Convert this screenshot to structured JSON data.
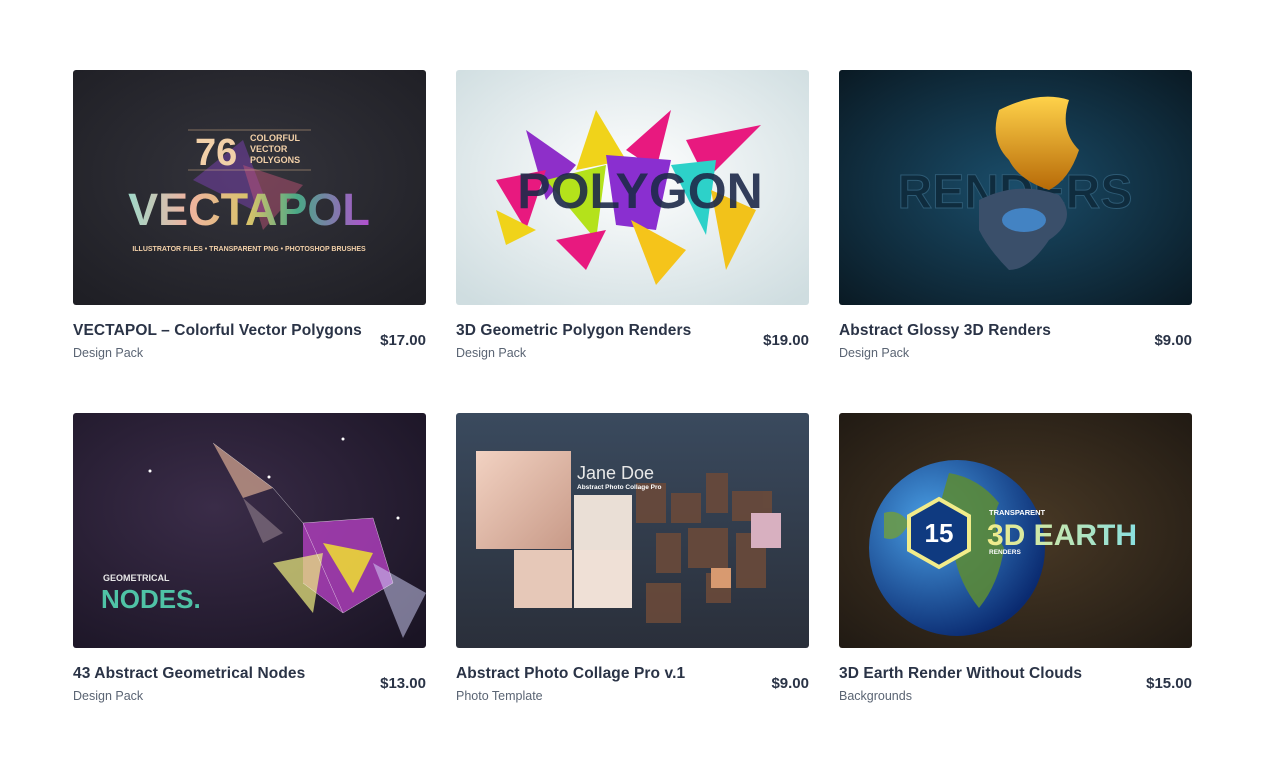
{
  "products": [
    {
      "title": "VECTAPOL – Colorful Vector Polygons",
      "category": "Design Pack",
      "price": "$17.00",
      "thumb": {
        "big_number": "76",
        "small_lines": [
          "COLORFUL",
          "VECTOR",
          "POLYGONS"
        ],
        "headline": "VECTAPOL",
        "footer": "ILLUSTRATOR FILES  •  TRANSPARENT PNG  •  PHOTOSHOP BRUSHES"
      }
    },
    {
      "title": "3D Geometric Polygon Renders",
      "category": "Design Pack",
      "price": "$19.00",
      "thumb": {
        "headline": "POLYGON"
      }
    },
    {
      "title": "Abstract Glossy 3D Renders",
      "category": "Design Pack",
      "price": "$9.00",
      "thumb": {
        "headline": "RENDERS"
      }
    },
    {
      "title": "43 Abstract Geometrical Nodes",
      "category": "Design Pack",
      "price": "$13.00",
      "thumb": {
        "small": "GEOMETRICAL",
        "headline": "NODES."
      }
    },
    {
      "title": "Abstract Photo Collage Pro v.1",
      "category": "Photo Template",
      "price": "$9.00",
      "thumb": {
        "name": "Jane Doe",
        "subtitle": "Abstract Photo Collage Pro"
      }
    },
    {
      "title": "3D Earth Render Without Clouds",
      "category": "Backgrounds",
      "price": "$15.00",
      "thumb": {
        "number": "15",
        "top": "TRANSPARENT",
        "headline": "3D EARTH",
        "bottom": "RENDERS"
      }
    }
  ]
}
